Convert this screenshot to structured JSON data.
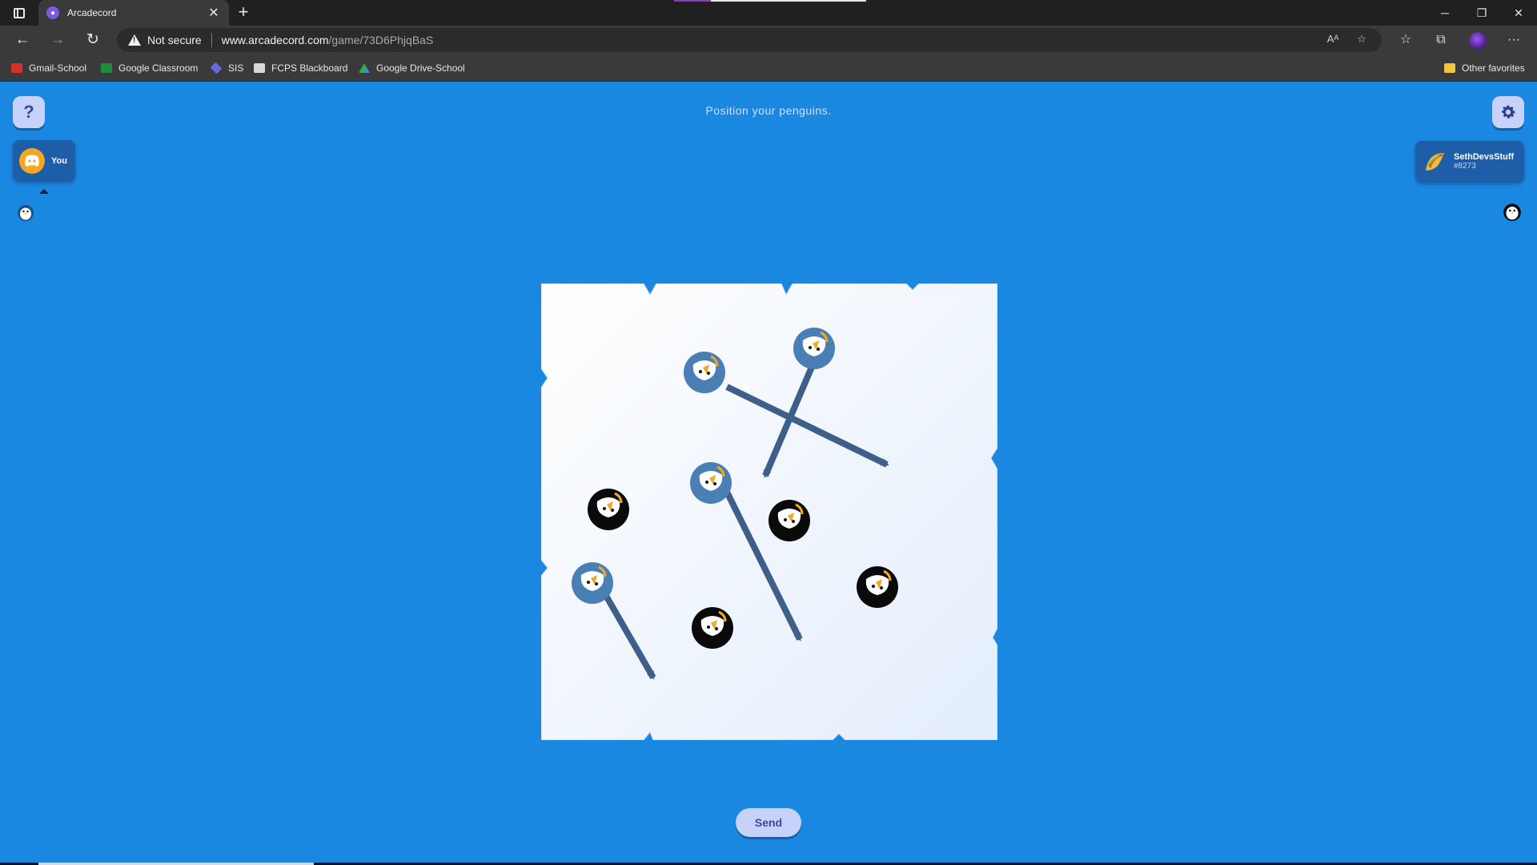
{
  "browser": {
    "tab_title": "Arcadecord",
    "security_label": "Not secure",
    "url_host": "www.arcadecord.com",
    "url_path": "/game/73D6PhjqBaS",
    "bookmarks": [
      {
        "label": "Gmail-School",
        "icon": "gmail-icon",
        "color": "#d93025"
      },
      {
        "label": "Google Classroom",
        "icon": "classroom-icon",
        "color": "#1e8e3e"
      },
      {
        "label": "SIS",
        "icon": "sis-icon",
        "color": "#6a6ae0"
      },
      {
        "label": "FCPS Blackboard",
        "icon": "blackboard-icon",
        "color": "#d8d8d8"
      },
      {
        "label": "Google Drive-School",
        "icon": "drive-icon",
        "color": "#34a853"
      }
    ],
    "other_favorites": "Other favorites"
  },
  "game": {
    "prompt": "Position your penguins.",
    "send_label": "Send",
    "help_label": "?",
    "you": {
      "label": "You",
      "avatar_color": "#f5a623"
    },
    "opponent": {
      "name": "SethDevsStuff",
      "tag": "#8273"
    },
    "colors": {
      "page_bg": "#1a87e0",
      "own_penguin": "#4a7fb5",
      "opponent_penguin": "#0a0a0a",
      "arrow": "#3e5f8a",
      "button_bg": "#c7d2fb"
    }
  }
}
